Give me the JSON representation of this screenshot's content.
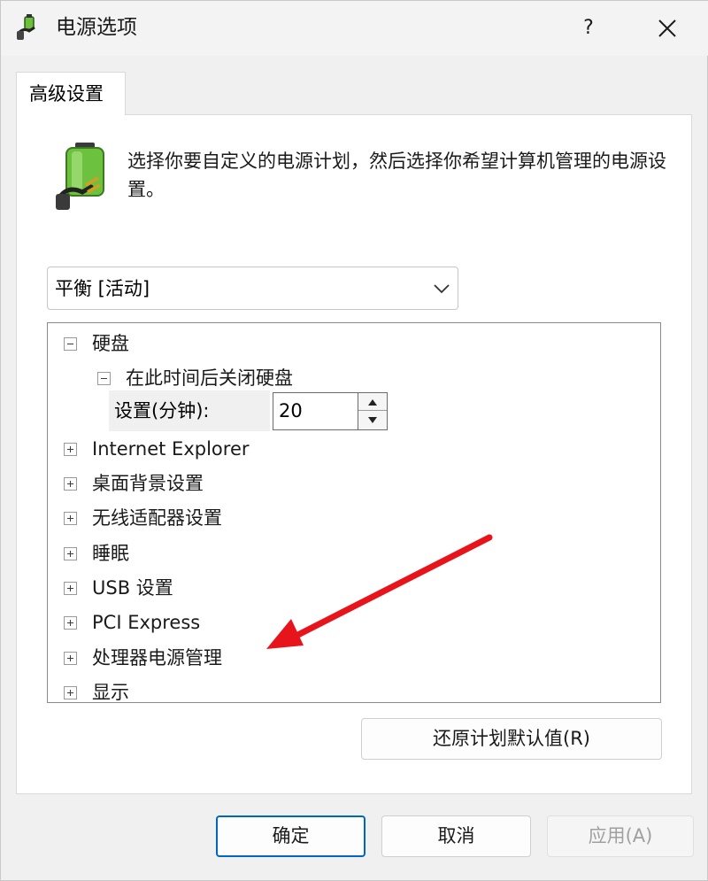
{
  "window": {
    "title": "电源选项",
    "help_label": "?",
    "close_label": "✕"
  },
  "tab": {
    "label": "高级设置"
  },
  "intro_text": "选择你要自定义的电源计划，然后选择你希望计算机管理的电源设置。",
  "plan_select": {
    "selected": "平衡 [活动]"
  },
  "tree": {
    "items": [
      {
        "label": "硬盘",
        "state": "expanded"
      },
      {
        "label": "在此时间后关闭硬盘",
        "state": "expanded"
      },
      {
        "label": "Internet Explorer",
        "state": "collapsed"
      },
      {
        "label": "桌面背景设置",
        "state": "collapsed"
      },
      {
        "label": "无线适配器设置",
        "state": "collapsed"
      },
      {
        "label": "睡眠",
        "state": "collapsed"
      },
      {
        "label": "USB 设置",
        "state": "collapsed"
      },
      {
        "label": "PCI Express",
        "state": "collapsed"
      },
      {
        "label": "处理器电源管理",
        "state": "collapsed"
      },
      {
        "label": "显示",
        "state": "collapsed"
      }
    ],
    "setting": {
      "label": "设置(分钟):",
      "value": "20"
    }
  },
  "buttons": {
    "restore": "还原计划默认值(R)",
    "ok": "确定",
    "cancel": "取消",
    "apply": "应用(A)"
  },
  "annotation": {
    "arrow_color": "#e8141c"
  },
  "colors": {
    "accent": "#0067c0",
    "battery_green": "#5fbf3a"
  }
}
